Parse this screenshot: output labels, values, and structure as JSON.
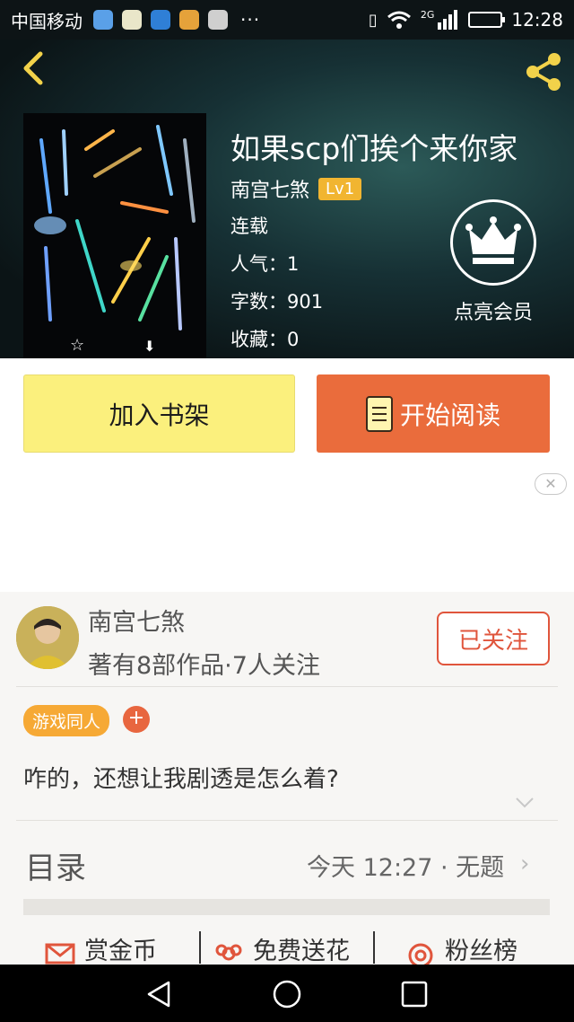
{
  "status_bar": {
    "carrier": "中国移动",
    "dots": "···",
    "network": "2G",
    "time": "12:28"
  },
  "book": {
    "title": "如果scp们挨个来你家",
    "author": "南宫七煞",
    "level": "Lv1",
    "status": "连载",
    "popularity_label": "人气：",
    "popularity": "1",
    "words_label": "字数：",
    "words": "901",
    "favorites_label": "收藏：",
    "favorites": "0"
  },
  "vip": {
    "label": "点亮会员"
  },
  "actions": {
    "add_shelf": "加入书架",
    "start_reading": "开始阅读"
  },
  "author_card": {
    "name": "南宫七煞",
    "stats": "著有8部作品·7人关注",
    "follow_label": "已关注",
    "tag": "游戏同人",
    "tag_add": "+",
    "description": "咋的，还想让我剧透是怎么着?"
  },
  "toc": {
    "label": "目录",
    "update": "今天 12:27 · 无题",
    "chevron": "›"
  },
  "bottom_tabs": [
    {
      "label": "赏金币",
      "icon": "envelope-icon"
    },
    {
      "label": "免费送花",
      "icon": "flower-icon"
    },
    {
      "label": "粉丝榜",
      "icon": "target-icon"
    }
  ],
  "colors": {
    "accent_orange": "#ea6c3c",
    "shelf_yellow": "#fbf07d",
    "level_badge": "#f1b531",
    "follow_red": "#e0553c"
  }
}
